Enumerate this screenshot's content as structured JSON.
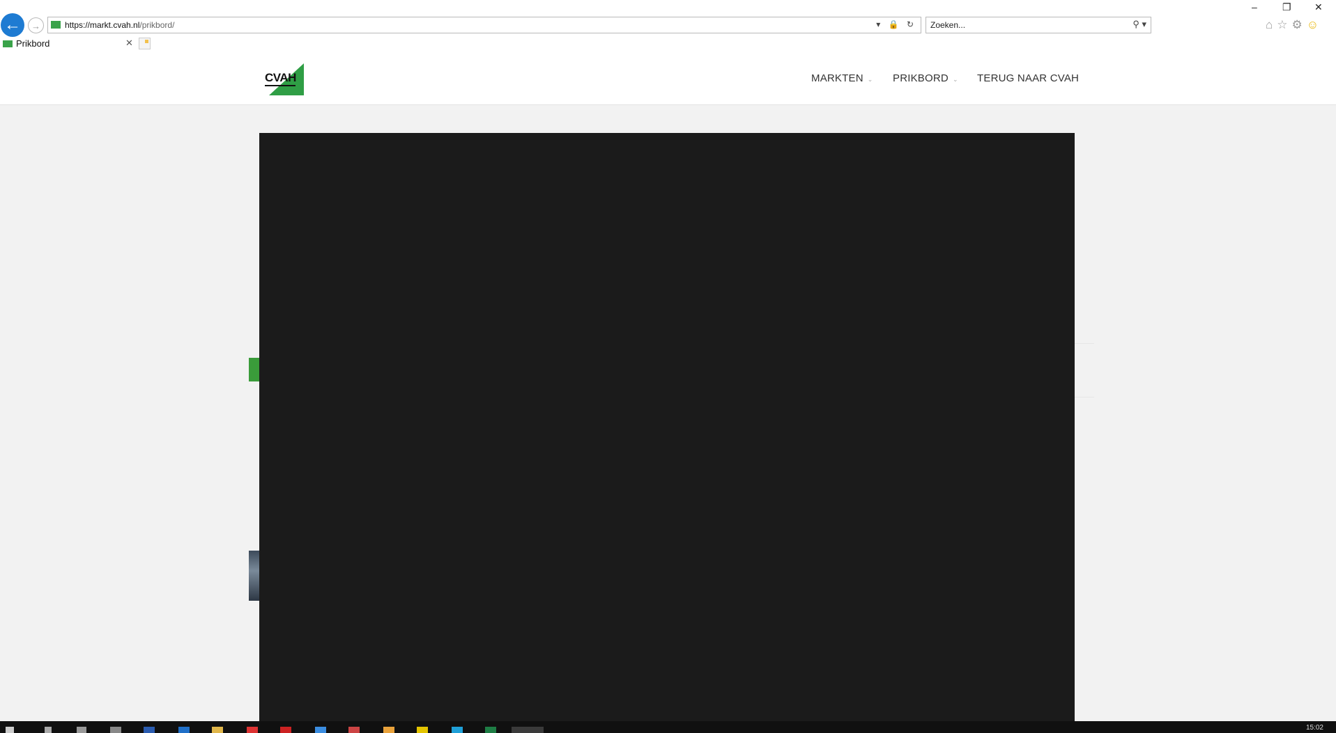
{
  "browser": {
    "url_host": "https://markt.cvah.nl",
    "url_path": "/prikbord/",
    "search_placeholder": "Zoeken...",
    "tab_title": "Prikbord",
    "window_controls": [
      "–",
      "❐",
      "✕"
    ]
  },
  "site": {
    "logo_text": "CVAH",
    "nav": [
      {
        "label": "MARKTEN",
        "has_dropdown": true
      },
      {
        "label": "PRIKBORD",
        "has_dropdown": true
      },
      {
        "label": "TERUG NAAR CVAH",
        "has_dropdown": false
      }
    ]
  },
  "icons": {
    "back": "back-arrow-icon",
    "forward": "forward-arrow-icon",
    "lock": "lock-icon",
    "refresh": "refresh-icon",
    "search": "search-icon",
    "home": "home-icon",
    "favorites": "star-icon",
    "settings": "gear-icon",
    "feedback": "smiley-icon"
  },
  "colors": {
    "brand_green": "#2f9e45",
    "overlay": "#1b1b1b",
    "browser_accent": "#1e7bd2"
  },
  "taskbar": {
    "clock": "15:02"
  }
}
